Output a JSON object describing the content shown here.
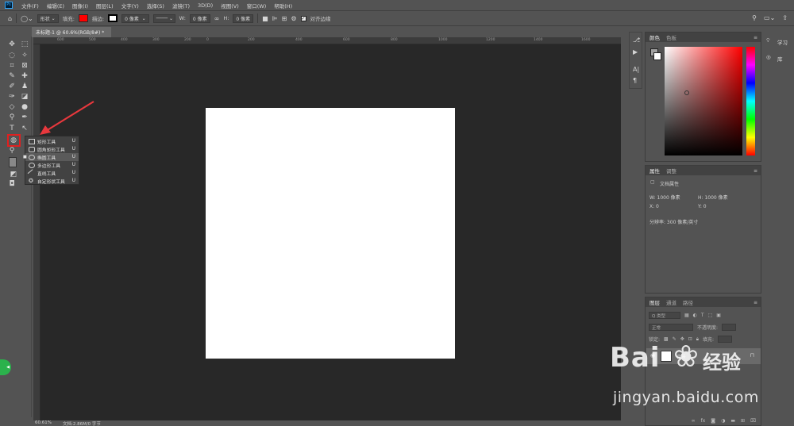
{
  "menubar": {
    "logo": "Ps",
    "items": [
      "文件(F)",
      "编辑(E)",
      "图像(I)",
      "图层(L)",
      "文字(Y)",
      "选择(S)",
      "滤镜(T)",
      "3D(D)",
      "视图(V)",
      "窗口(W)",
      "帮助(H)"
    ]
  },
  "options": {
    "mode": "形状",
    "fill_label": "填充:",
    "fill_color": "#ff0000",
    "stroke_label": "描边:",
    "stroke_width": "0 像素",
    "w_label": "W:",
    "w_value": "0 像素",
    "h_label": "H:",
    "h_value": "0 像素",
    "align_edges": "对齐边缘"
  },
  "document": {
    "tab_title": "未标题-1 @ 60.6%(RGB/8#) *"
  },
  "flyout": {
    "items": [
      {
        "label": "矩形工具",
        "key": "U"
      },
      {
        "label": "圆角矩形工具",
        "key": "U"
      },
      {
        "label": "椭圆工具",
        "key": "U"
      },
      {
        "label": "多边形工具",
        "key": "U"
      },
      {
        "label": "直线工具",
        "key": "U"
      },
      {
        "label": "自定形状工具",
        "key": "U"
      }
    ]
  },
  "status": {
    "zoom": "60.61%",
    "doc_info": "文档:2.86M/0 字节"
  },
  "panels": {
    "color_tabs": [
      "颜色",
      "色板"
    ],
    "props_tabs": [
      "属性",
      "调整"
    ],
    "doc_props": "文档属性",
    "w": "W: 1000 像素",
    "h": "H: 1000 像素",
    "x": "X: 0",
    "y": "Y: 0",
    "resolution": "分辨率: 300 像素/英寸",
    "layers_tabs": [
      "图层",
      "通道",
      "路径"
    ],
    "kind": "Q 类型",
    "blend": "正常",
    "opacity_label": "不透明度:",
    "lock_label": "锁定:",
    "fill_label": "填充:",
    "layer_name": "背景"
  },
  "learn": {
    "learn": "学习",
    "library": "库"
  },
  "watermark": {
    "logo": "Bai",
    "cn": "经验",
    "url": "jingyan.baidu.com"
  }
}
